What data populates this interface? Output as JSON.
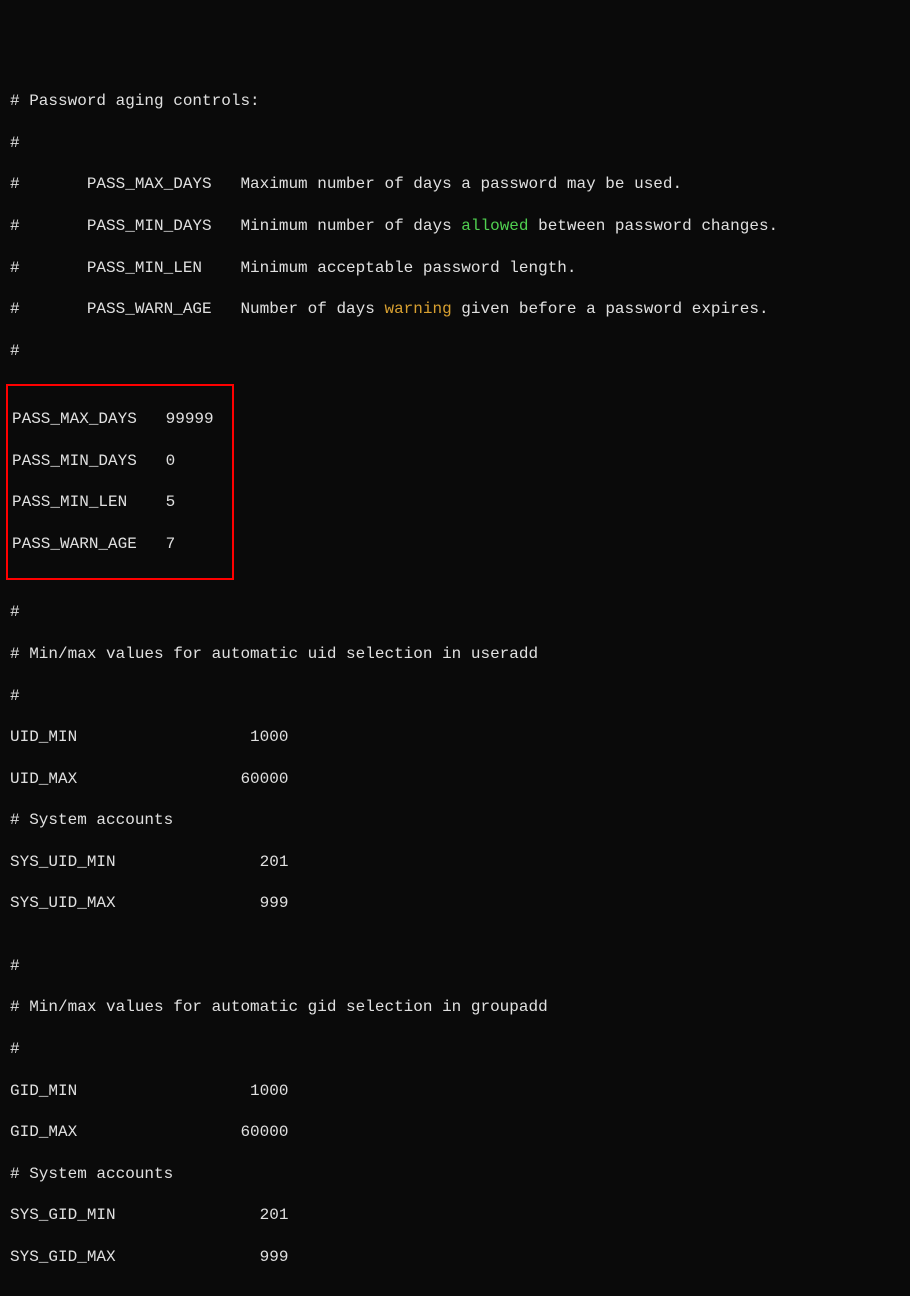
{
  "header_comment_title": "# Password aging controls:",
  "header_comment_hash": "#",
  "desc_max_days": "#       PASS_MAX_DAYS   Maximum number of days a password may be used.",
  "desc_min_days_pre": "#       PASS_MIN_DAYS   Minimum number of days ",
  "desc_min_days_allowed": "allowed",
  "desc_min_days_post": " between password changes.",
  "desc_min_len": "#       PASS_MIN_LEN    Minimum acceptable password length.",
  "desc_warn_pre": "#       PASS_WARN_AGE   Number of days ",
  "desc_warn_warning": "warning",
  "desc_warn_post": " given before a password expires.",
  "hash_only": "#",
  "pass_max_days": "PASS_MAX_DAYS   99999",
  "pass_min_days": "PASS_MIN_DAYS   0",
  "pass_min_len": "PASS_MIN_LEN    5",
  "pass_warn_age": "PASS_WARN_AGE   7",
  "uid_section_title": "# Min/max values for automatic uid selection in useradd",
  "uid_min": "UID_MIN                  1000",
  "uid_max": "UID_MAX                 60000",
  "sys_accounts": "# System accounts",
  "sys_uid_min": "SYS_UID_MIN               201",
  "sys_uid_max": "SYS_UID_MAX               999",
  "gid_section_title": "# Min/max values for automatic gid selection in groupadd",
  "gid_min": "GID_MIN                  1000",
  "gid_max": "GID_MAX                 60000",
  "sys_gid_min": "SYS_GID_MIN               201",
  "sys_gid_max": "SYS_GID_MAX               999"
}
